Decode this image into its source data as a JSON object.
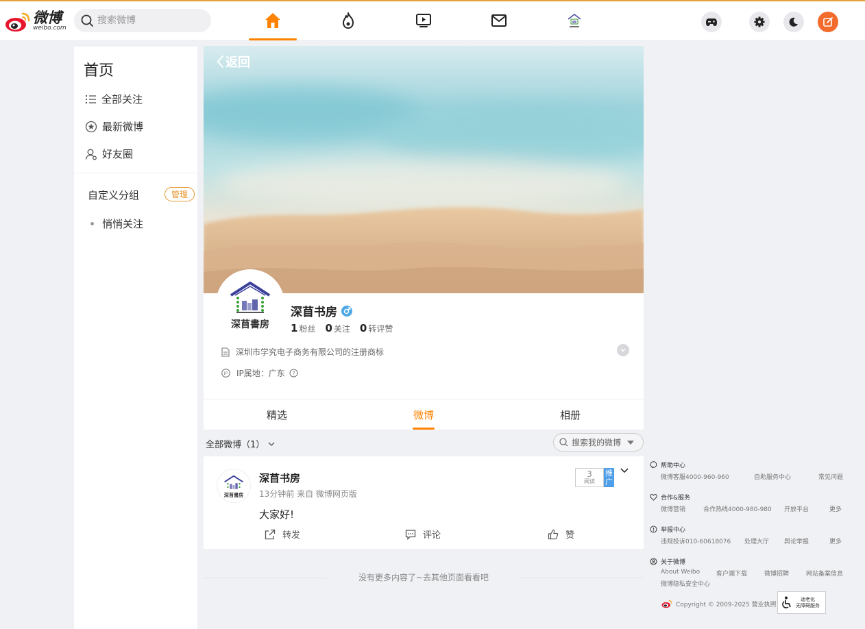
{
  "header": {
    "logo_cn": "微博",
    "logo_en": "weibo.com",
    "search_placeholder": "搜索微博",
    "nav": [
      "home-icon",
      "hot-fire-icon",
      "video-icon",
      "mail-icon",
      "shop-thumbnail-icon"
    ],
    "right_buttons": [
      "game-icon",
      "settings-icon",
      "moon-icon",
      "compose-icon"
    ]
  },
  "sidebar": {
    "title": "首页",
    "items": [
      {
        "label": "全部关注",
        "icon": "list-icon"
      },
      {
        "label": "最新微博",
        "icon": "star-circle-icon"
      },
      {
        "label": "好友圈",
        "icon": "friends-icon"
      }
    ],
    "group_title": "自定义分组",
    "manage_label": "管理",
    "sub_items": [
      {
        "label": "悄悄关注"
      }
    ]
  },
  "profile": {
    "back_label": "返回",
    "name": "深苜书房",
    "avatar_caption": "深苜書房",
    "stats": [
      {
        "value": "1",
        "label": "粉丝"
      },
      {
        "value": "0",
        "label": "关注"
      },
      {
        "value": "0",
        "label": "转评赞"
      }
    ],
    "company": "深圳市学究电子商务有限公司的注册商标",
    "ip_location": "IP属地：广东",
    "tabs": [
      "精选",
      "微博",
      "相册"
    ],
    "active_tab": "微博"
  },
  "feed": {
    "filter_label": "全部微博（1）",
    "search_placeholder": "搜索我的微博",
    "posts": [
      {
        "author": "深苜书房",
        "meta": "13分钟前  来自 微博网页版",
        "text": "大家好!",
        "reads_count": "3",
        "reads_label": "阅读",
        "promo_label": "推广",
        "actions": [
          {
            "label": "转发",
            "icon": "repost-icon"
          },
          {
            "label": "评论",
            "icon": "comment-icon"
          },
          {
            "label": "赞",
            "icon": "like-icon"
          }
        ]
      }
    ],
    "no_more": "没有更多内容了~去其他页面看看吧"
  },
  "footer": {
    "sections": [
      {
        "title": "帮助中心",
        "links": [
          "微博客服4000-960-960",
          "自助服务中心",
          "常见问题"
        ]
      },
      {
        "title": "合作&服务",
        "links": [
          "微博营销",
          "合作热线4000-980-980",
          "开放平台",
          "更多"
        ]
      },
      {
        "title": "举报中心",
        "links": [
          "违规投诉010-60618076",
          "处理大厅",
          "舆论举报",
          "更多"
        ]
      },
      {
        "title": "关于微博",
        "links": [
          "About Weibo",
          "客户端下载",
          "微博招聘",
          "网站备案信息",
          "微博隐私安全中心"
        ]
      }
    ],
    "copyright": "Copyright © 2009-2025 营业执照",
    "a11y_line1": "适老化",
    "a11y_line2": "无障碍服务"
  },
  "colors": {
    "accent": "#ff8200",
    "verify_blue": "#4fa9e6",
    "brand_red": "#e6162d"
  }
}
